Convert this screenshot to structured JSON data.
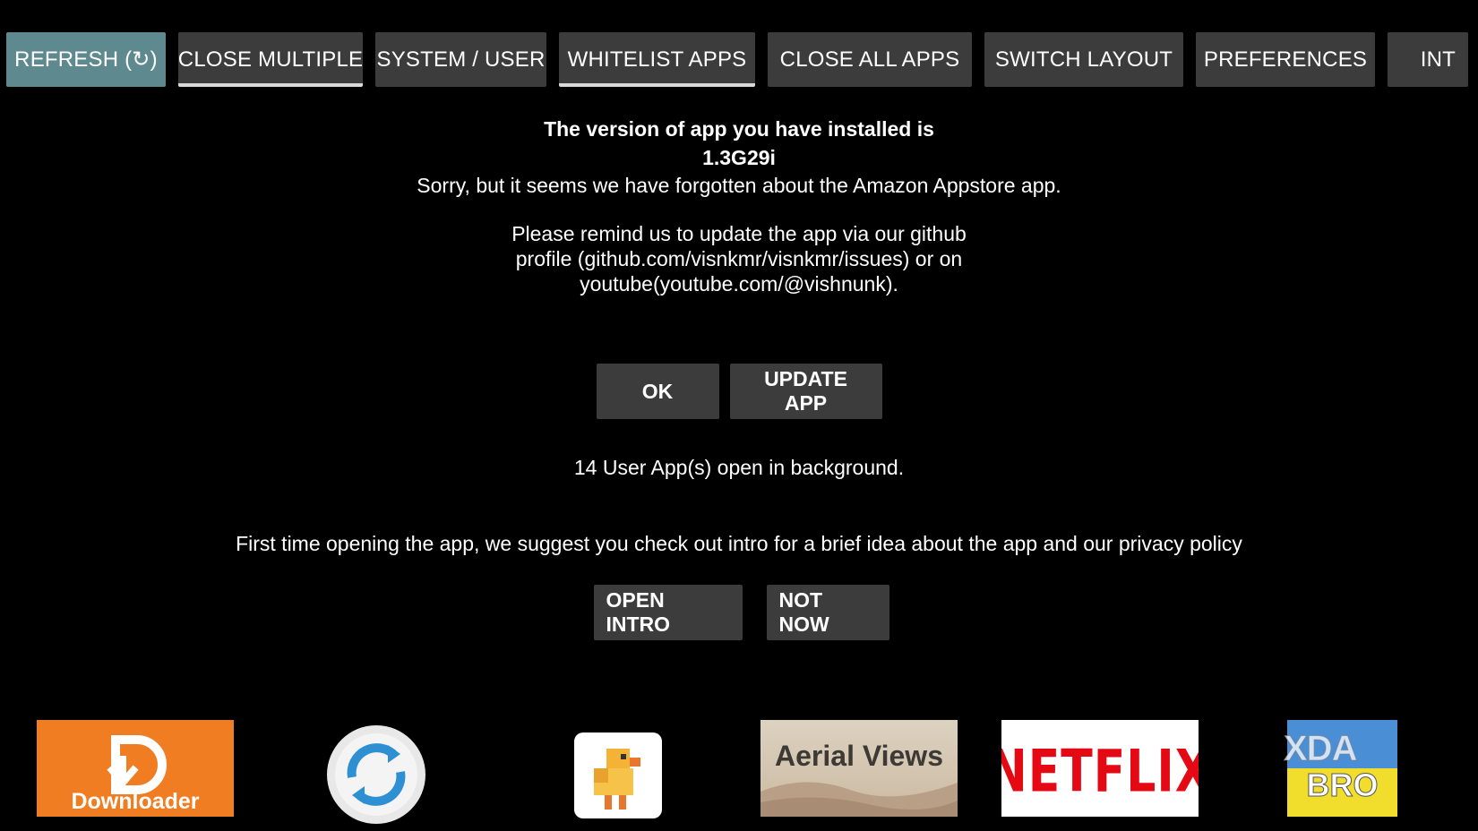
{
  "tabs": [
    {
      "label": "REFRESH (↻)",
      "state": "selected"
    },
    {
      "label": "CLOSE MULTIPLE",
      "state": "underlined"
    },
    {
      "label": "SYSTEM / USER",
      "state": "normal"
    },
    {
      "label": "WHITELIST APPS",
      "state": "underlined"
    },
    {
      "label": "CLOSE ALL APPS",
      "state": "normal"
    },
    {
      "label": "SWITCH LAYOUT",
      "state": "normal"
    },
    {
      "label": "PREFERENCES",
      "state": "normal"
    },
    {
      "label": "INT",
      "state": "normal"
    }
  ],
  "dialog": {
    "title": "The version of app you have installed is",
    "version": "1.3G29i",
    "message": "Sorry, but it seems we have forgotten about the Amazon Appstore app.",
    "remind": "Please remind us to update the app via our github profile (github.com/visnkmr/visnkmr/issues) or on youtube(youtube.com/@vishnunk).",
    "ok_label": "OK",
    "update_label": "UPDATE APP"
  },
  "status": {
    "background_apps": "14 User  App(s) open in background."
  },
  "intro": {
    "text": "First time opening the app, we suggest you check out intro for a brief idea about the app and our privacy policy",
    "open_label": "OPEN INTRO",
    "not_now_label": "NOT NOW"
  },
  "apps": [
    {
      "name": "Downloader",
      "label": "Downloader",
      "icon": "downloader-icon",
      "color": "#f07d22"
    },
    {
      "name": "Sync",
      "label": "",
      "icon": "sync-icon",
      "color": "#2f8fd3"
    },
    {
      "name": "Duck",
      "label": "",
      "icon": "duck-icon",
      "color": "#f5a623"
    },
    {
      "name": "Aerial Views",
      "label": "Aerial Views",
      "icon": "aerial-views-icon",
      "color": "#d8ccb8"
    },
    {
      "name": "Netflix",
      "label": "NETFLIX",
      "icon": "netflix-icon",
      "color": "#e50914"
    },
    {
      "name": "TV Bro",
      "label": "BRO",
      "icon": "tv-bro-icon",
      "color": "#f0dd2c"
    }
  ],
  "watermark": "XDA",
  "colors": {
    "background": "#000000",
    "button": "#3c3c3c",
    "active_tab": "#5e8a8f",
    "text": "#ffffff"
  }
}
